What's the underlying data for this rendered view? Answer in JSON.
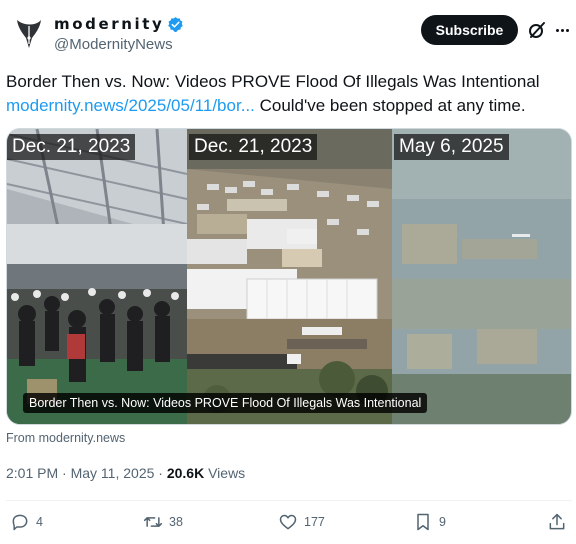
{
  "colors": {
    "accent": "#1d9bf0",
    "text": "#0f1419",
    "muted": "#536471",
    "verified": "#1d9bf0"
  },
  "author": {
    "display_name": "modernity",
    "handle": "@ModernityNews",
    "avatar_icon": "quill-pen-logo-icon",
    "verified_icon": "verified-badge-icon"
  },
  "header": {
    "subscribe_label": "Subscribe",
    "grok_icon": "grok-icon",
    "more_icon": "more-options-icon"
  },
  "tweet": {
    "text_line1": "Border Then vs. Now: Videos PROVE Flood Of Illegals Was Intentional",
    "link_text": "modernity.news/2025/05/11/bor...",
    "text_line2": " Could've been stopped at any time."
  },
  "media": {
    "panels": [
      {
        "date": "Dec. 21, 2023"
      },
      {
        "date": "Dec. 21, 2023"
      },
      {
        "date": "May 6, 2025"
      }
    ],
    "caption": "Border Then vs. Now: Videos PROVE Flood Of Illegals Was Intentional"
  },
  "source": "From modernity.news",
  "meta": {
    "time": "2:01 PM",
    "separator": " · ",
    "date": "May 11, 2025",
    "views_count": "20.6K",
    "views_label": " Views"
  },
  "actions": {
    "replies": {
      "icon": "reply-icon",
      "count": "4"
    },
    "reposts": {
      "icon": "repost-icon",
      "count": "38"
    },
    "likes": {
      "icon": "heart-icon",
      "count": "177"
    },
    "bookmarks": {
      "icon": "bookmark-icon",
      "count": "9"
    },
    "share": {
      "icon": "share-icon"
    }
  }
}
